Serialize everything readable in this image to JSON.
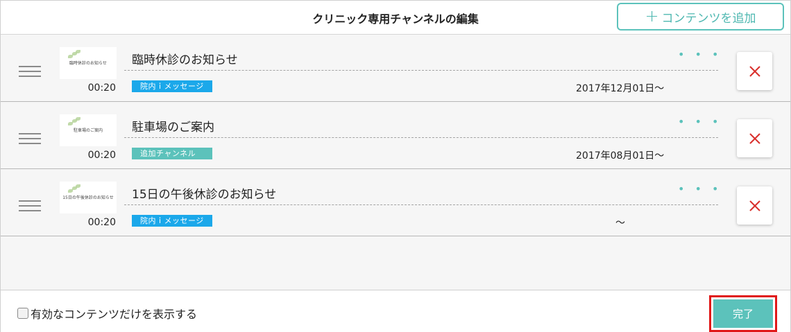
{
  "header": {
    "title": "クリニック専用チャンネルの編集",
    "add_button": {
      "plus": "+",
      "label": "コンテンツを追加"
    }
  },
  "items": [
    {
      "thumb_text": "臨時休診のお知らせ",
      "duration": "00:20",
      "title": "臨時休診のお知らせ",
      "tag": "院内ｉメッセージ",
      "tag_color": "#1ba8ea",
      "date": "2017年12月01日〜",
      "menu": "• • •"
    },
    {
      "thumb_text": "駐車場のご案内",
      "duration": "00:20",
      "title": "駐車場のご案内",
      "tag": "追加チャンネル",
      "tag_color": "#5cc2bb",
      "date": "2017年08月01日〜",
      "menu": "• • •"
    },
    {
      "thumb_text": "15日の午後休診のお知らせ",
      "duration": "00:20",
      "title": "15日の午後休診のお知らせ",
      "tag": "院内ｉメッセージ",
      "tag_color": "#1ba8ea",
      "date": "〜",
      "menu": "• • •"
    }
  ],
  "footer": {
    "filter_label": "有効なコンテンツだけを表示する",
    "done_label": "完了"
  },
  "colors": {
    "accent": "#5cc2bb",
    "delete": "#d9302c",
    "highlight": "#e01818"
  }
}
